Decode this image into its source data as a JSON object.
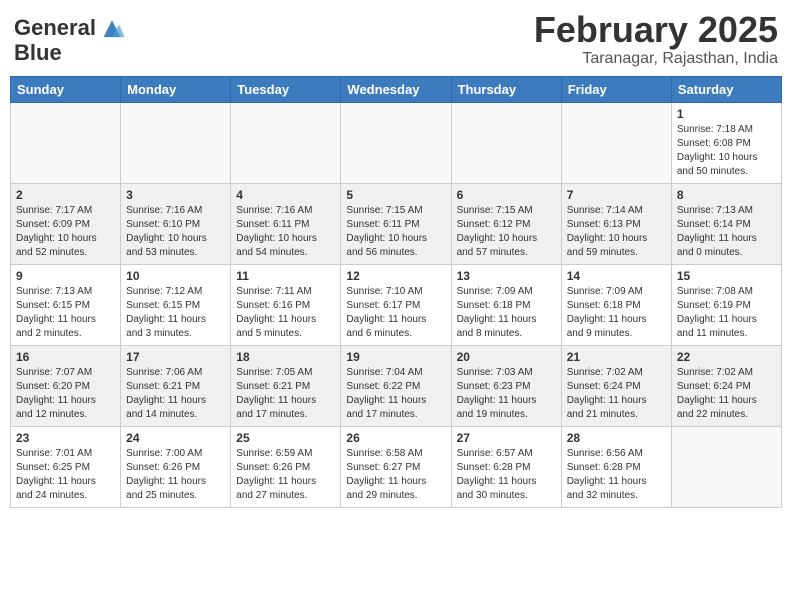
{
  "header": {
    "logo_general": "General",
    "logo_blue": "Blue",
    "title": "February 2025",
    "subtitle": "Taranagar, Rajasthan, India"
  },
  "weekdays": [
    "Sunday",
    "Monday",
    "Tuesday",
    "Wednesday",
    "Thursday",
    "Friday",
    "Saturday"
  ],
  "weeks": [
    [
      {
        "day": "",
        "info": ""
      },
      {
        "day": "",
        "info": ""
      },
      {
        "day": "",
        "info": ""
      },
      {
        "day": "",
        "info": ""
      },
      {
        "day": "",
        "info": ""
      },
      {
        "day": "",
        "info": ""
      },
      {
        "day": "1",
        "info": "Sunrise: 7:18 AM\nSunset: 6:08 PM\nDaylight: 10 hours\nand 50 minutes."
      }
    ],
    [
      {
        "day": "2",
        "info": "Sunrise: 7:17 AM\nSunset: 6:09 PM\nDaylight: 10 hours\nand 52 minutes."
      },
      {
        "day": "3",
        "info": "Sunrise: 7:16 AM\nSunset: 6:10 PM\nDaylight: 10 hours\nand 53 minutes."
      },
      {
        "day": "4",
        "info": "Sunrise: 7:16 AM\nSunset: 6:11 PM\nDaylight: 10 hours\nand 54 minutes."
      },
      {
        "day": "5",
        "info": "Sunrise: 7:15 AM\nSunset: 6:11 PM\nDaylight: 10 hours\nand 56 minutes."
      },
      {
        "day": "6",
        "info": "Sunrise: 7:15 AM\nSunset: 6:12 PM\nDaylight: 10 hours\nand 57 minutes."
      },
      {
        "day": "7",
        "info": "Sunrise: 7:14 AM\nSunset: 6:13 PM\nDaylight: 10 hours\nand 59 minutes."
      },
      {
        "day": "8",
        "info": "Sunrise: 7:13 AM\nSunset: 6:14 PM\nDaylight: 11 hours\nand 0 minutes."
      }
    ],
    [
      {
        "day": "9",
        "info": "Sunrise: 7:13 AM\nSunset: 6:15 PM\nDaylight: 11 hours\nand 2 minutes."
      },
      {
        "day": "10",
        "info": "Sunrise: 7:12 AM\nSunset: 6:15 PM\nDaylight: 11 hours\nand 3 minutes."
      },
      {
        "day": "11",
        "info": "Sunrise: 7:11 AM\nSunset: 6:16 PM\nDaylight: 11 hours\nand 5 minutes."
      },
      {
        "day": "12",
        "info": "Sunrise: 7:10 AM\nSunset: 6:17 PM\nDaylight: 11 hours\nand 6 minutes."
      },
      {
        "day": "13",
        "info": "Sunrise: 7:09 AM\nSunset: 6:18 PM\nDaylight: 11 hours\nand 8 minutes."
      },
      {
        "day": "14",
        "info": "Sunrise: 7:09 AM\nSunset: 6:18 PM\nDaylight: 11 hours\nand 9 minutes."
      },
      {
        "day": "15",
        "info": "Sunrise: 7:08 AM\nSunset: 6:19 PM\nDaylight: 11 hours\nand 11 minutes."
      }
    ],
    [
      {
        "day": "16",
        "info": "Sunrise: 7:07 AM\nSunset: 6:20 PM\nDaylight: 11 hours\nand 12 minutes."
      },
      {
        "day": "17",
        "info": "Sunrise: 7:06 AM\nSunset: 6:21 PM\nDaylight: 11 hours\nand 14 minutes."
      },
      {
        "day": "18",
        "info": "Sunrise: 7:05 AM\nSunset: 6:21 PM\nDaylight: 11 hours\nand 17 minutes."
      },
      {
        "day": "19",
        "info": "Sunrise: 7:04 AM\nSunset: 6:22 PM\nDaylight: 11 hours\nand 17 minutes."
      },
      {
        "day": "20",
        "info": "Sunrise: 7:03 AM\nSunset: 6:23 PM\nDaylight: 11 hours\nand 19 minutes."
      },
      {
        "day": "21",
        "info": "Sunrise: 7:02 AM\nSunset: 6:24 PM\nDaylight: 11 hours\nand 21 minutes."
      },
      {
        "day": "22",
        "info": "Sunrise: 7:02 AM\nSunset: 6:24 PM\nDaylight: 11 hours\nand 22 minutes."
      }
    ],
    [
      {
        "day": "23",
        "info": "Sunrise: 7:01 AM\nSunset: 6:25 PM\nDaylight: 11 hours\nand 24 minutes."
      },
      {
        "day": "24",
        "info": "Sunrise: 7:00 AM\nSunset: 6:26 PM\nDaylight: 11 hours\nand 25 minutes."
      },
      {
        "day": "25",
        "info": "Sunrise: 6:59 AM\nSunset: 6:26 PM\nDaylight: 11 hours\nand 27 minutes."
      },
      {
        "day": "26",
        "info": "Sunrise: 6:58 AM\nSunset: 6:27 PM\nDaylight: 11 hours\nand 29 minutes."
      },
      {
        "day": "27",
        "info": "Sunrise: 6:57 AM\nSunset: 6:28 PM\nDaylight: 11 hours\nand 30 minutes."
      },
      {
        "day": "28",
        "info": "Sunrise: 6:56 AM\nSunset: 6:28 PM\nDaylight: 11 hours\nand 32 minutes."
      },
      {
        "day": "",
        "info": ""
      }
    ]
  ]
}
